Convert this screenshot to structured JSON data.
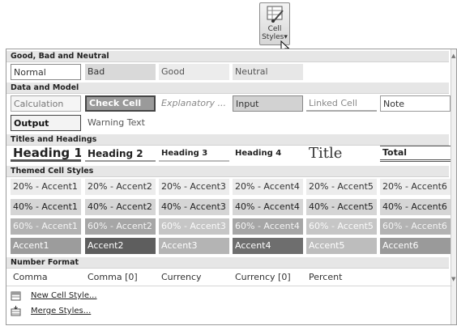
{
  "ribbon": {
    "cell_styles_label_1": "Cell",
    "cell_styles_label_2": "Styles",
    "dropdown_arrow": "▾",
    "icon": "cell-styles-icon"
  },
  "sections": {
    "good_bad_neutral": {
      "header": "Good, Bad and Neutral",
      "cells": [
        "Normal",
        "Bad",
        "Good",
        "Neutral"
      ]
    },
    "data_and_model": {
      "header": "Data and Model",
      "row1": [
        "Calculation",
        "Check Cell",
        "Explanatory ...",
        "Input",
        "Linked Cell",
        "Note"
      ],
      "row2": [
        "Output",
        "Warning Text"
      ]
    },
    "titles_and_headings": {
      "header": "Titles and Headings",
      "cells": [
        "Heading 1",
        "Heading 2",
        "Heading 3",
        "Heading 4",
        "Title",
        "Total"
      ]
    },
    "themed_cell_styles": {
      "header": "Themed Cell Styles",
      "row20": [
        "20% - Accent1",
        "20% - Accent2",
        "20% - Accent3",
        "20% - Accent4",
        "20% - Accent5",
        "20% - Accent6"
      ],
      "row40": [
        "40% - Accent1",
        "40% - Accent2",
        "40% - Accent3",
        "40% - Accent4",
        "40% - Accent5",
        "40% - Accent6"
      ],
      "row60": [
        "60% - Accent1",
        "60% - Accent2",
        "60% - Accent3",
        "60% - Accent4",
        "60% - Accent5",
        "60% - Accent6"
      ],
      "accent": [
        "Accent1",
        "Accent2",
        "Accent3",
        "Accent4",
        "Accent5",
        "Accent6"
      ]
    },
    "number_format": {
      "header": "Number Format",
      "cells": [
        "Comma",
        "Comma [0]",
        "Currency",
        "Currency [0]",
        "Percent"
      ]
    }
  },
  "menu": {
    "new_cell_style": "New Cell Style...",
    "merge_styles": "Merge Styles..."
  },
  "scrollbar": {
    "up_arrow": "▲",
    "down_arrow": "▼"
  }
}
